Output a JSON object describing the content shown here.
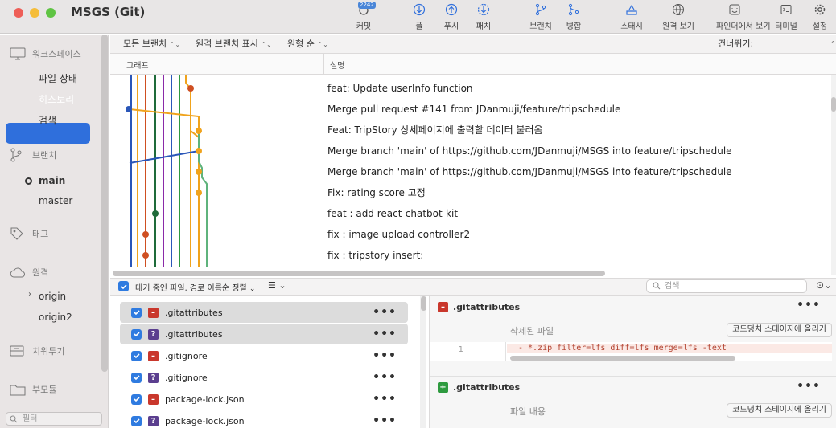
{
  "window": {
    "title": "MSGS (Git)"
  },
  "toolbar": [
    {
      "label": "커밋",
      "icon": "commit-icon",
      "badge": "2242"
    },
    {
      "label": "풀",
      "icon": "pull-icon"
    },
    {
      "label": "푸시",
      "icon": "push-icon"
    },
    {
      "label": "패치",
      "icon": "fetch-icon"
    },
    {
      "label": "브랜치",
      "icon": "branch-icon"
    },
    {
      "label": "병합",
      "icon": "merge-icon"
    },
    {
      "label": "스태시",
      "icon": "stash-icon"
    },
    {
      "label": "원격 보기",
      "icon": "globe-icon"
    },
    {
      "label": "파인더에서 보기",
      "icon": "finder-icon"
    },
    {
      "label": "터미널",
      "icon": "terminal-icon"
    },
    {
      "label": "설정",
      "icon": "gear-icon"
    }
  ],
  "sidebar": {
    "workspace": "워크스페이스",
    "file_status": "파일 상태",
    "history": "히스토리",
    "search": "검색",
    "branches": "브랜치",
    "branch_items": [
      "main",
      "master"
    ],
    "tags": "태그",
    "remotes": "원격",
    "remote_items": [
      "origin",
      "origin2"
    ],
    "stashes": "치워두기",
    "submodules": "부모듈",
    "filter_placeholder": "필터"
  },
  "filters": {
    "all_branches": "모든 브랜치",
    "show_remote": "원격 브랜치 표시",
    "order": "원형 순",
    "jump": "건너뛰기:"
  },
  "columns": {
    "graph": "그래프",
    "description": "설명"
  },
  "commits": [
    "feat: Update userInfo function",
    "Merge pull request #141 from JDanmuji/feature/tripschedule",
    "Feat: TripStory 상세페이지에 출력할 데이터 불러옴",
    "Merge branch 'main' of https://github.com/JDanmuji/MSGS into feature/tripschedule",
    "Merge branch 'main' of https://github.com/JDanmuji/MSGS into feature/tripschedule",
    "Fix: rating score 고정",
    "feat : add react-chatbot-kit",
    "fix : image upload controller2",
    "fix : tripstory insert:"
  ],
  "staged": {
    "label": "대기 중인 파일, 경로 이름순 정렬",
    "search_placeholder": "검색"
  },
  "files": [
    {
      "name": ".gitattributes",
      "status": "deleted",
      "selected": true
    },
    {
      "name": ".gitattributes",
      "status": "untracked",
      "selected": true
    },
    {
      "name": ".gitignore",
      "status": "deleted",
      "selected": false
    },
    {
      "name": ".gitignore",
      "status": "untracked",
      "selected": false
    },
    {
      "name": "package-lock.json",
      "status": "deleted",
      "selected": false
    },
    {
      "name": "package-lock.json",
      "status": "untracked",
      "selected": false
    }
  ],
  "diff": [
    {
      "file": ".gitattributes",
      "status": "deleted",
      "section": "삭제된 파일",
      "stage_btn": "코드덩치 스테이지에 올리기",
      "line_no": "1",
      "code": "- *.zip filter=lfs diff=lfs merge=lfs -text"
    },
    {
      "file": ".gitattributes",
      "status": "added",
      "section": "파일 내용",
      "stage_btn": "코드덩치 스테이지에 올리기"
    }
  ],
  "colors": {
    "accent": "#2f6fdc",
    "deleted": "#c9372c",
    "untracked": "#5b3f8f",
    "added": "#2e9a3f"
  }
}
